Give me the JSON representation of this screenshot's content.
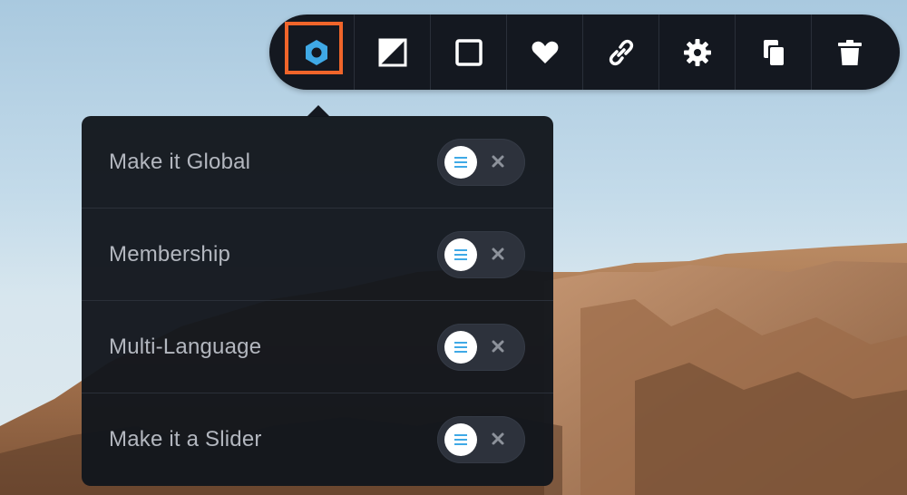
{
  "toolbar": {
    "buttons": [
      {
        "name": "hexagon-icon",
        "active": true
      },
      {
        "name": "half-square-icon",
        "active": false
      },
      {
        "name": "square-icon",
        "active": false
      },
      {
        "name": "heart-icon",
        "active": false
      },
      {
        "name": "link-icon",
        "active": false
      },
      {
        "name": "gear-icon",
        "active": false
      },
      {
        "name": "copy-icon",
        "active": false
      },
      {
        "name": "trash-icon",
        "active": false
      }
    ]
  },
  "panel": {
    "rows": [
      {
        "label": "Make it Global",
        "on": false
      },
      {
        "label": "Membership",
        "on": false
      },
      {
        "label": "Multi-Language",
        "on": false
      },
      {
        "label": "Make it a Slider",
        "on": false
      }
    ]
  },
  "colors": {
    "accent": "#3fa9e6",
    "highlight": "#f0652a",
    "toolbar_bg": "#141820"
  }
}
